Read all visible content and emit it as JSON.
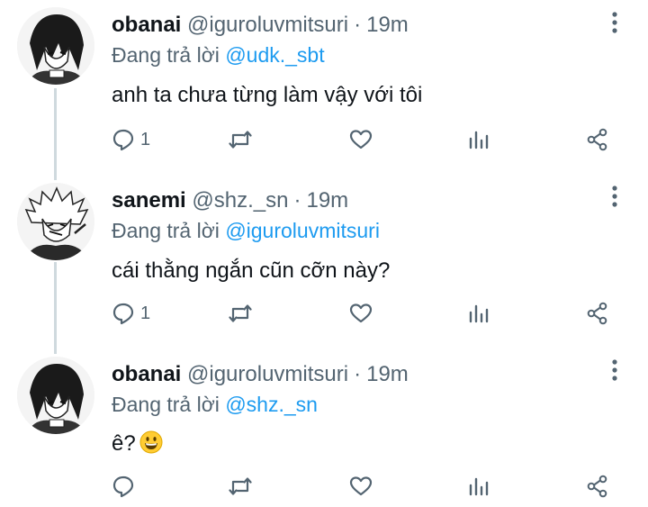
{
  "thread": [
    {
      "name": "obanai",
      "handle": "@iguroluvmitsuri",
      "separator": "·",
      "time": "19m",
      "reply_prefix": "Đang trả lời",
      "reply_to": "@udk._sbt",
      "text": "anh ta chưa từng làm vậy với tôi",
      "reply_count": "1"
    },
    {
      "name": "sanemi",
      "handle": "@shz._sn",
      "separator": "·",
      "time": "19m",
      "reply_prefix": "Đang trả lời",
      "reply_to": "@iguroluvmitsuri",
      "text": "cái thằng ngắn cũn cỡn này?",
      "reply_count": "1"
    },
    {
      "name": "obanai",
      "handle": "@iguroluvmitsuri",
      "separator": "·",
      "time": "19m",
      "reply_prefix": "Đang trả lời",
      "reply_to": "@shz._sn",
      "text": "ê?",
      "emoji": "grinning-face",
      "reply_count": ""
    }
  ],
  "colors": {
    "mention": "#1d9bf0",
    "secondary": "#536471",
    "thread_line": "#cfd9de"
  },
  "icons": [
    "reply-icon",
    "retweet-icon",
    "like-icon",
    "views-icon",
    "share-icon",
    "more-options-icon"
  ]
}
